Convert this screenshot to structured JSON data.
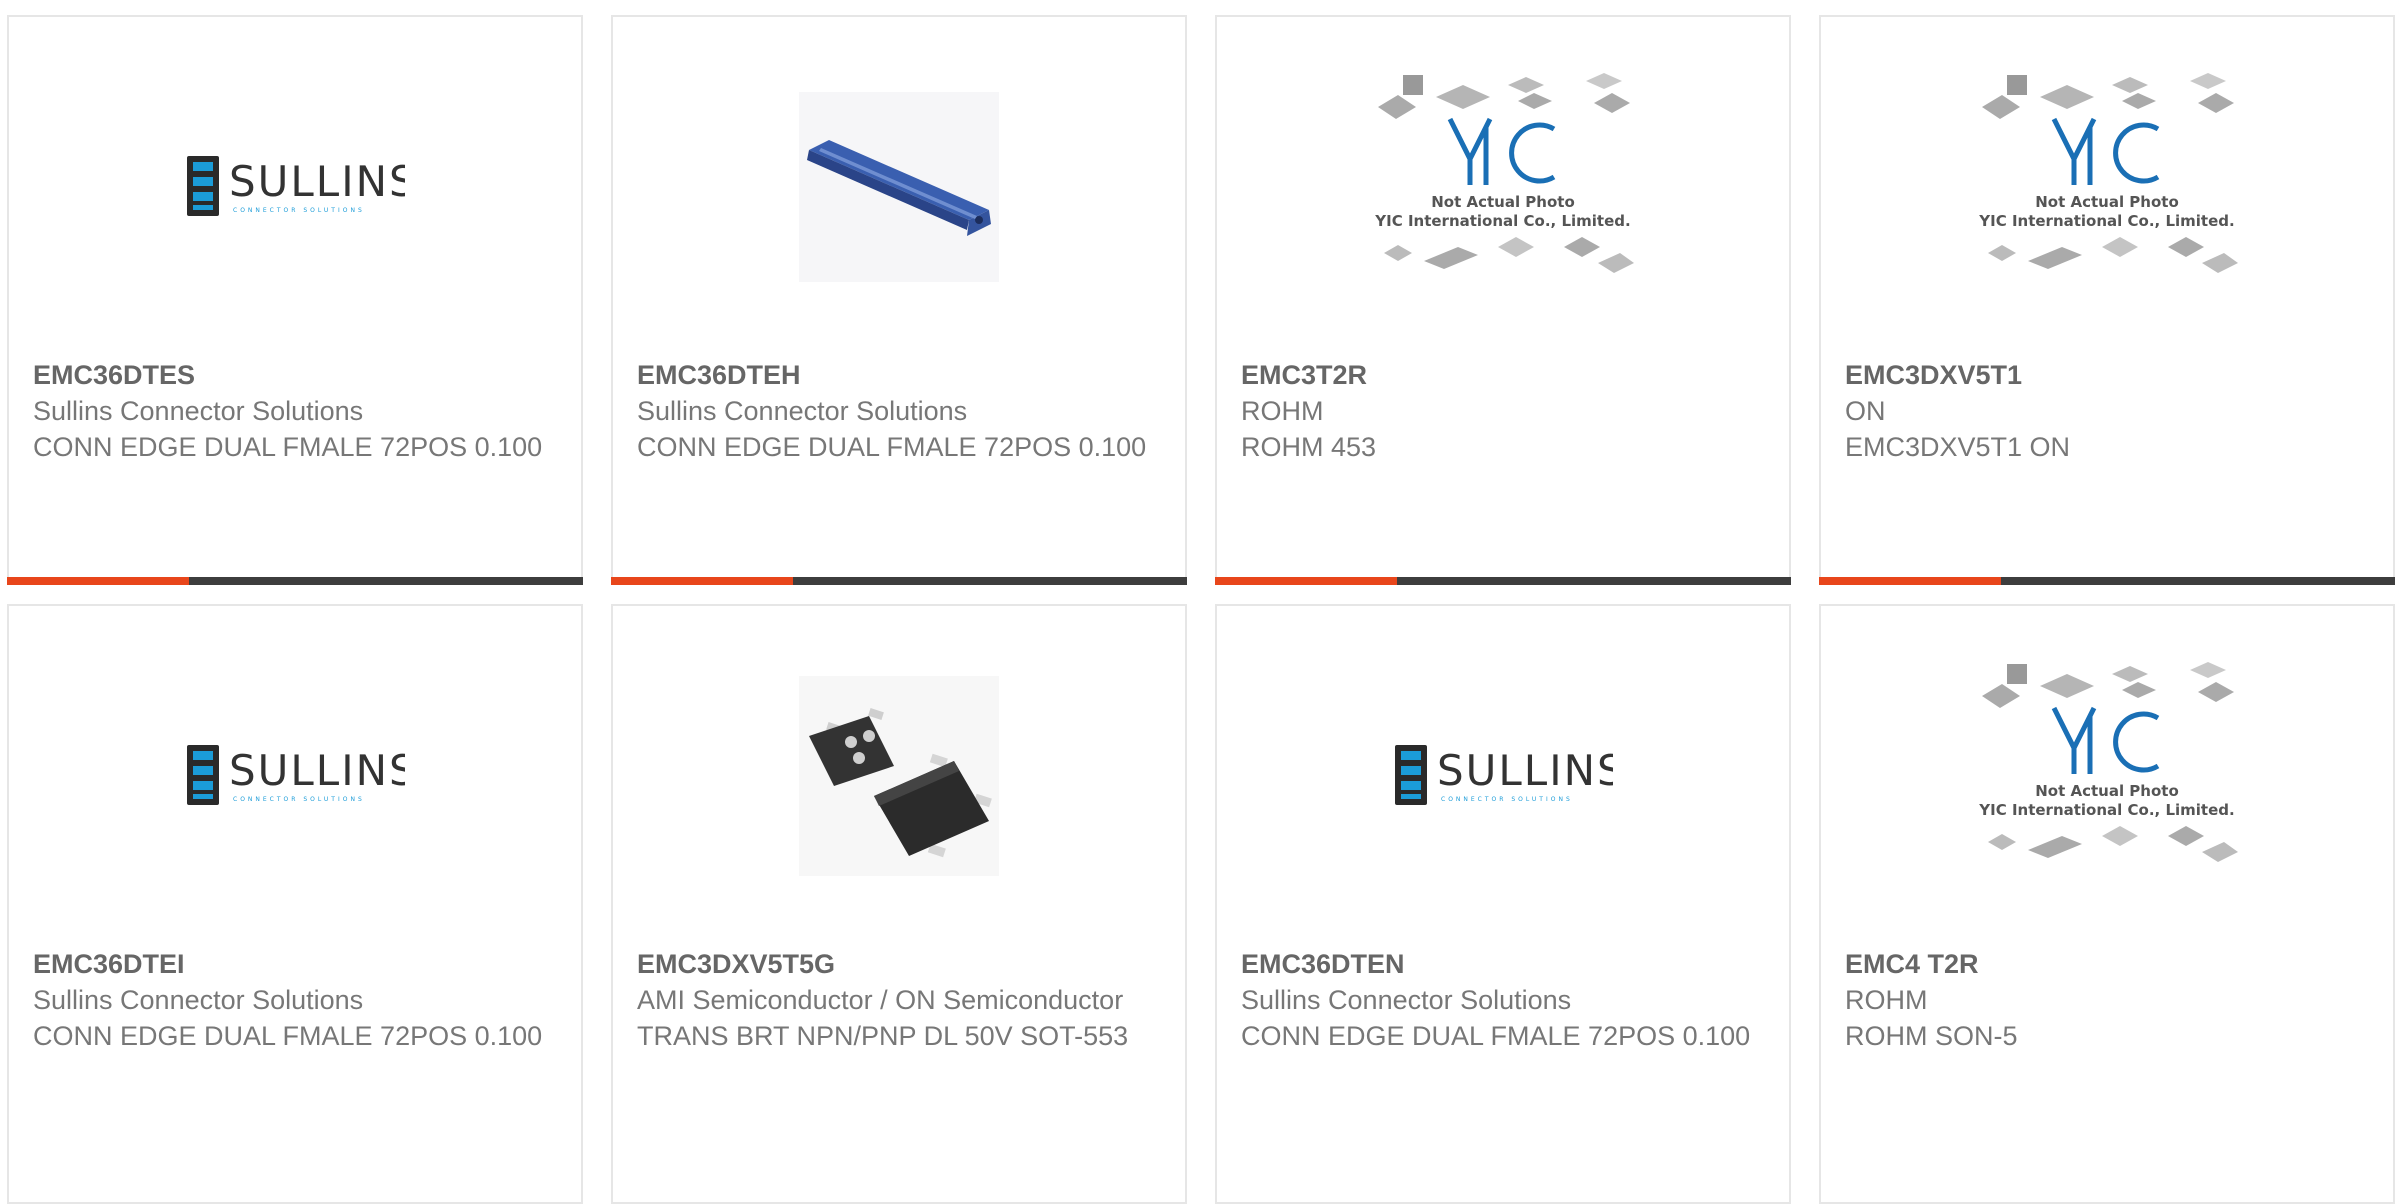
{
  "colors": {
    "accent": "#e8461b",
    "bar_dark": "#3d3d3d",
    "brand_sullins": "#1b9cd8",
    "brand_yic": "#1a6fb5"
  },
  "products": [
    {
      "part_number": "EMC36DTES",
      "manufacturer": "Sullins Connector Solutions",
      "description": "CONN EDGE DUAL FMALE 72POS 0.100",
      "image": "sullins-logo"
    },
    {
      "part_number": "EMC36DTEH",
      "manufacturer": "Sullins Connector Solutions",
      "description": "CONN EDGE DUAL FMALE 72POS 0.100",
      "image": "edge-connector-photo"
    },
    {
      "part_number": "EMC3T2R",
      "manufacturer": "ROHM",
      "description": "ROHM 453",
      "image": "yic-placeholder",
      "image_caption_1": "Not Actual Photo",
      "image_caption_2": "YIC International Co., Limited."
    },
    {
      "part_number": "EMC3DXV5T1",
      "manufacturer": "ON",
      "description": "EMC3DXV5T1 ON",
      "image": "yic-placeholder",
      "image_caption_1": "Not Actual Photo",
      "image_caption_2": "YIC International Co., Limited."
    },
    {
      "part_number": "EMC36DTEI",
      "manufacturer": "Sullins Connector Solutions",
      "description": "CONN EDGE DUAL FMALE 72POS 0.100",
      "image": "sullins-logo"
    },
    {
      "part_number": "EMC3DXV5T5G",
      "manufacturer": "AMI Semiconductor / ON Semiconductor",
      "description": "TRANS BRT NPN/PNP DL 50V SOT-553",
      "image": "sot553-photo"
    },
    {
      "part_number": "EMC36DTEN",
      "manufacturer": "Sullins Connector Solutions",
      "description": "CONN EDGE DUAL FMALE 72POS 0.100",
      "image": "sullins-logo"
    },
    {
      "part_number": "EMC4 T2R",
      "manufacturer": "ROHM",
      "description": "ROHM SON-5",
      "image": "yic-placeholder",
      "image_caption_1": "Not Actual Photo",
      "image_caption_2": "YIC International Co., Limited."
    }
  ]
}
